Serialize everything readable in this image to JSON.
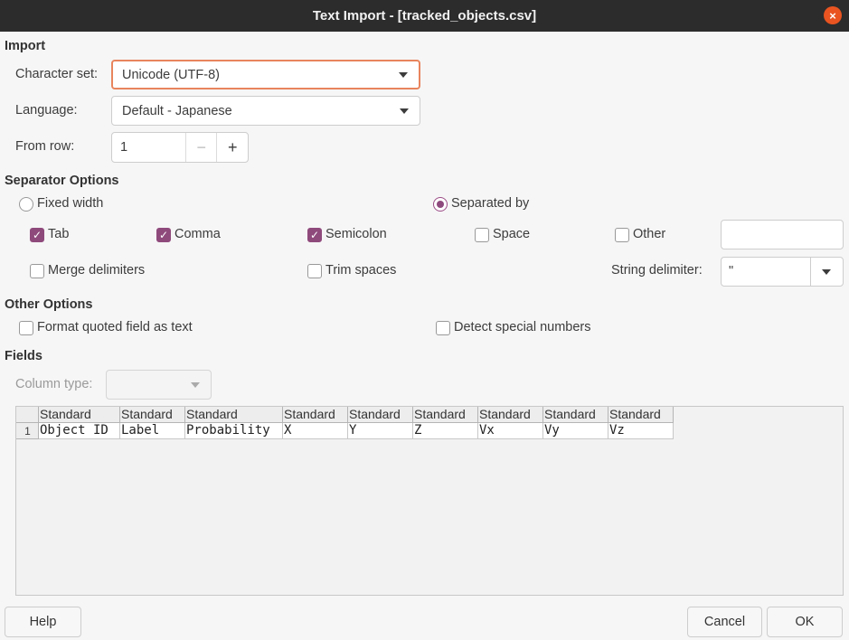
{
  "window": {
    "title": "Text Import - [tracked_objects.csv]",
    "close_symbol": "×"
  },
  "import": {
    "heading": "Import",
    "charset_label": "Character set:",
    "charset_value": "Unicode (UTF-8)",
    "language_label": "Language:",
    "language_value": "Default - Japanese",
    "from_row_label": "From row:",
    "from_row_value": "1",
    "minus": "−",
    "plus": "+"
  },
  "separator": {
    "heading": "Separator Options",
    "fixed_width": "Fixed width",
    "separated_by": "Separated by",
    "mode": "separated_by",
    "tab": "Tab",
    "comma": "Comma",
    "semicolon": "Semicolon",
    "space": "Space",
    "other": "Other",
    "other_value": "",
    "merge_delimiters": "Merge delimiters",
    "trim_spaces": "Trim spaces",
    "string_delimiter_label": "String delimiter:",
    "string_delimiter_value": "\"",
    "checked": {
      "tab": true,
      "comma": true,
      "semicolon": true,
      "space": false,
      "other": false,
      "merge": false,
      "trim": false
    }
  },
  "other_options": {
    "heading": "Other Options",
    "format_quoted": "Format quoted field as text",
    "detect_special": "Detect special numbers"
  },
  "fields": {
    "heading": "Fields",
    "column_type_label": "Column type:",
    "column_type_value": "",
    "row_number": "1",
    "headers": [
      "Standard",
      "Standard",
      "Standard",
      "Standard",
      "Standard",
      "Standard",
      "Standard",
      "Standard",
      "Standard"
    ],
    "row": [
      "Object ID",
      "Label",
      "Probability",
      "X",
      "Y",
      "Z",
      "Vx",
      "Vy",
      "Vz"
    ]
  },
  "buttons": {
    "help": "Help",
    "cancel": "Cancel",
    "ok": "OK"
  },
  "colors": {
    "accent": "#e95420",
    "check": "#8f4a7c",
    "titlebar": "#2c2c2c"
  }
}
